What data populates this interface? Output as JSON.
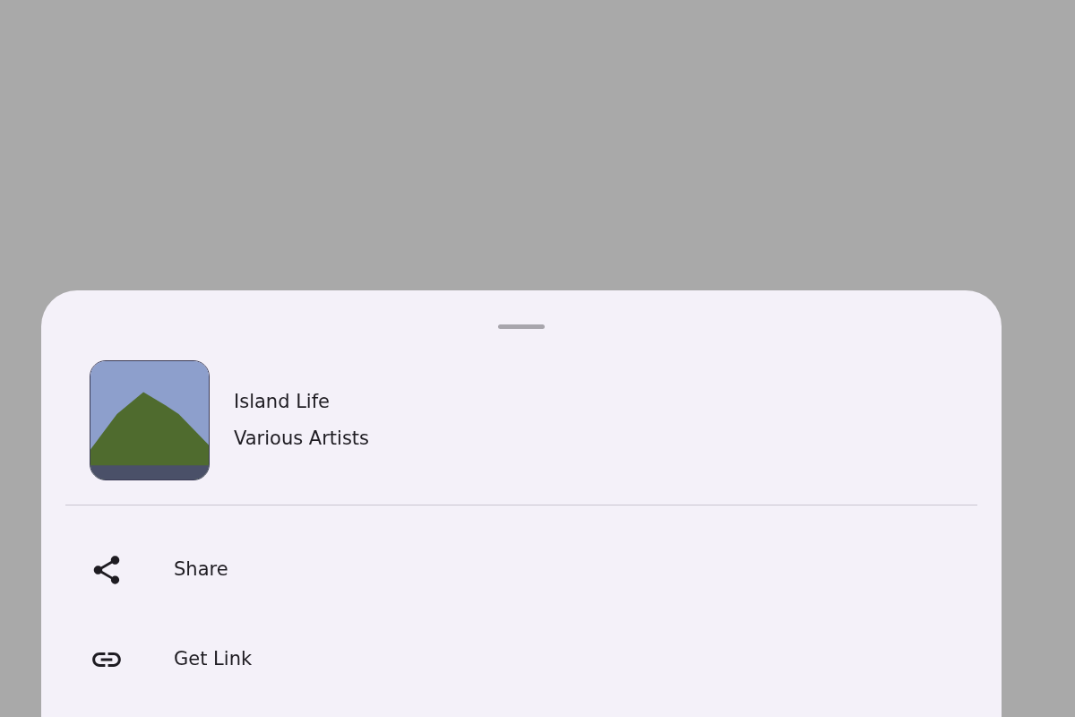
{
  "album": {
    "title": "Island Life",
    "artist": "Various Artists"
  },
  "actions": [
    {
      "kind": "share",
      "label": "Share"
    },
    {
      "kind": "link",
      "label": "Get Link"
    }
  ]
}
